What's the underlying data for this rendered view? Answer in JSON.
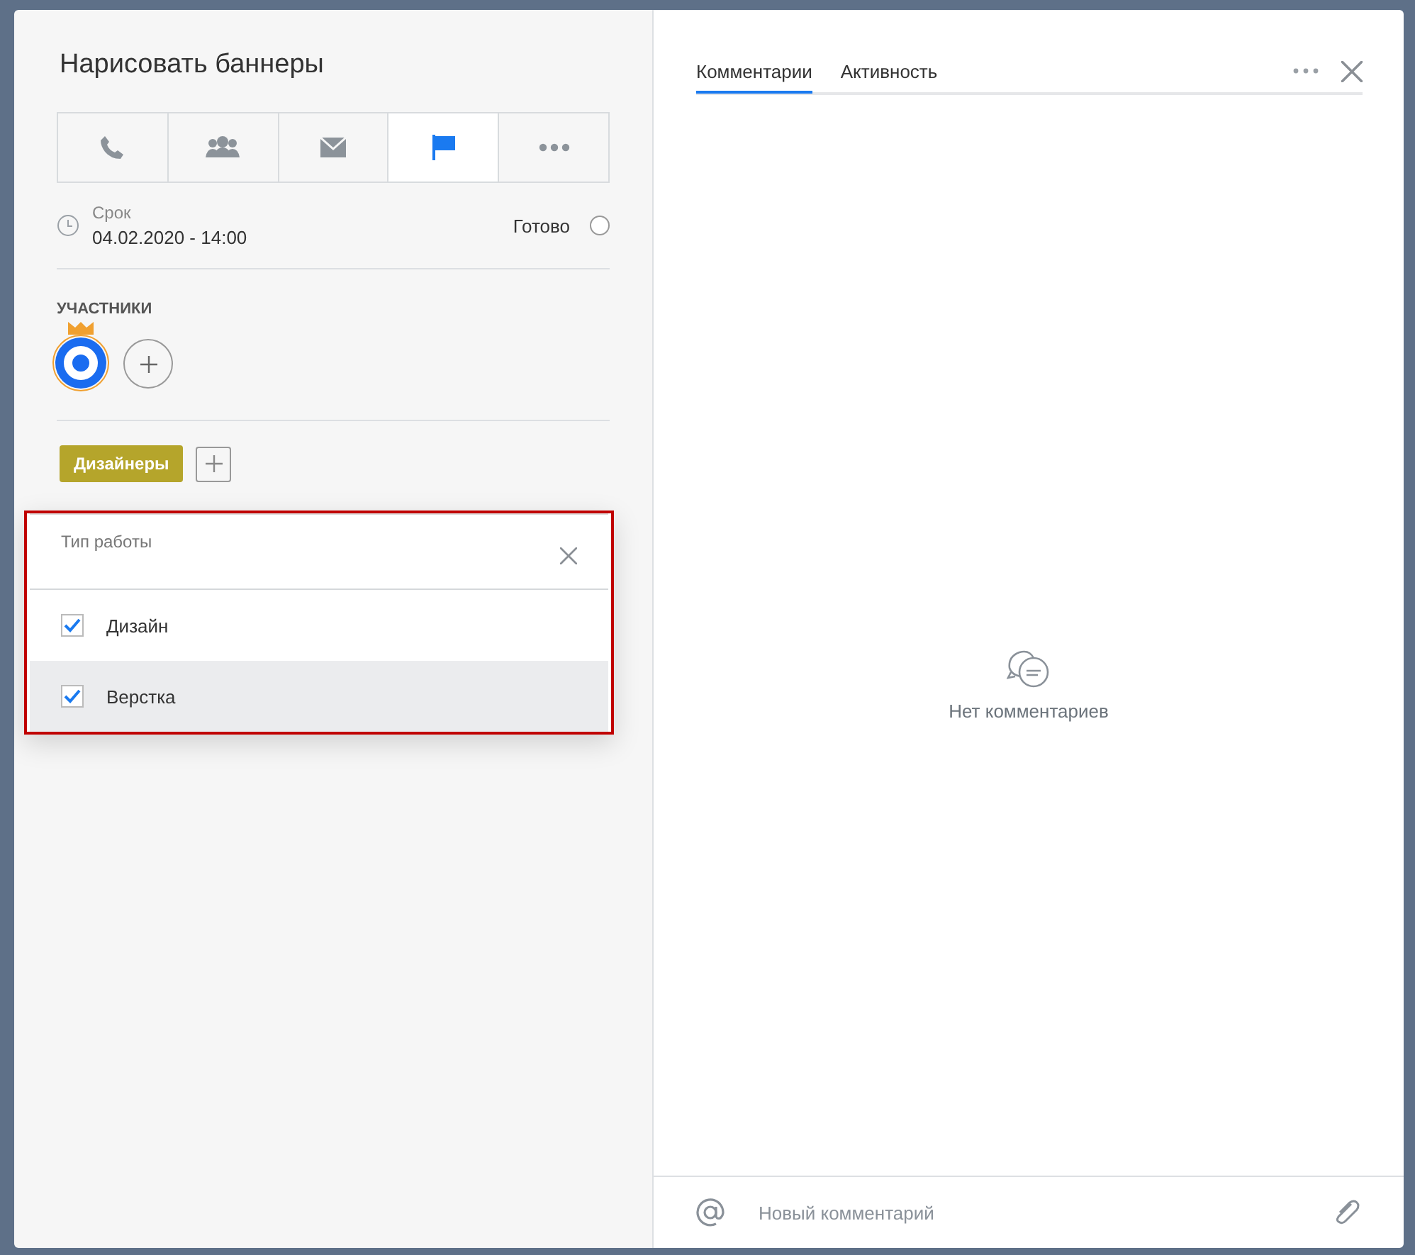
{
  "task": {
    "title": "Нарисовать баннеры"
  },
  "actions": [
    {
      "kind": "phone",
      "selected": false
    },
    {
      "kind": "people",
      "selected": false
    },
    {
      "kind": "mail",
      "selected": false
    },
    {
      "kind": "flag",
      "selected": true
    },
    {
      "kind": "more",
      "selected": false
    }
  ],
  "deadline": {
    "label": "Срок",
    "value": "04.02.2020 - 14:00"
  },
  "done": {
    "label": "Готово",
    "checked": false
  },
  "participants": {
    "heading": "УЧАСТНИКИ",
    "members": [
      {
        "owner": true
      }
    ]
  },
  "tags": [
    {
      "label": "Дизайнеры",
      "color": "#b5a52b"
    }
  ],
  "popup": {
    "title": "Тип работы",
    "highlighted_frame": true,
    "options": [
      {
        "label": "Дизайн",
        "checked": true,
        "highlighted": false
      },
      {
        "label": "Верстка",
        "checked": true,
        "highlighted": true
      }
    ]
  },
  "tabs": [
    {
      "label": "Комментарии",
      "selected": true
    },
    {
      "label": "Активность",
      "selected": false
    }
  ],
  "empty": {
    "text": "Нет комментариев"
  },
  "comment": {
    "placeholder": "Новый комментарий"
  }
}
